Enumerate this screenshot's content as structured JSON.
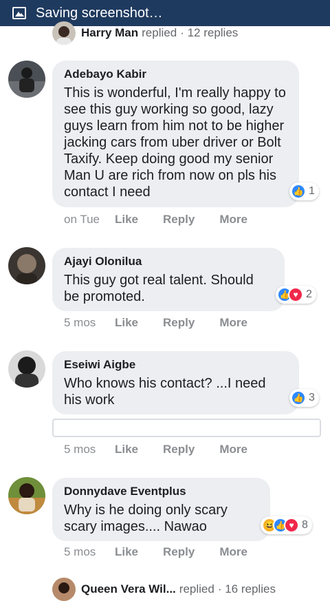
{
  "status_bar": {
    "text": "Saving screenshot…",
    "icon": "image-icon"
  },
  "reply_summary_top": {
    "name": "Harry Man",
    "action": "replied",
    "count": "· 12 replies"
  },
  "comments": [
    {
      "author": "Adebayo Kabir",
      "text": "This is wonderful, I'm really happy to see this guy working so good, lazy guys learn from him not to be higher jacking cars from uber driver or Bolt Taxify. Keep doing good my senior Man U are rich from now on pls his contact I need",
      "reactions": [
        "like"
      ],
      "reaction_count": "1",
      "time": "on Tue",
      "like": "Like",
      "reply": "Reply",
      "more": "More"
    },
    {
      "author": "Ajayi Olonilua",
      "text": "This guy got real talent. Should be promoted.",
      "reactions": [
        "like",
        "love"
      ],
      "reaction_count": "2",
      "time": "5 mos",
      "like": "Like",
      "reply": "Reply",
      "more": "More"
    },
    {
      "author": "Eseiwi Aigbe",
      "text": "Who knows his contact? ...I need his work",
      "reactions": [
        "like"
      ],
      "reaction_count": "3",
      "time": "5 mos",
      "like": "Like",
      "reply": "Reply",
      "more": "More"
    },
    {
      "author": "Donnydave Eventplus",
      "text": "Why is he doing only scary scary images.... Nawao",
      "reactions": [
        "haha",
        "like",
        "love"
      ],
      "reaction_count": "8",
      "time": "5 mos",
      "like": "Like",
      "reply": "Reply",
      "more": "More"
    }
  ],
  "reply_summary_bottom": {
    "name": "Queen Vera Wil...",
    "action": "replied",
    "count": "· 16 replies"
  },
  "colors": {
    "status_bar": "#1f3a5f",
    "bubble": "#eceef1",
    "like": "#2d88ff",
    "love": "#f0284a",
    "haha": "#f7b125",
    "muted": "#8a8d91"
  }
}
